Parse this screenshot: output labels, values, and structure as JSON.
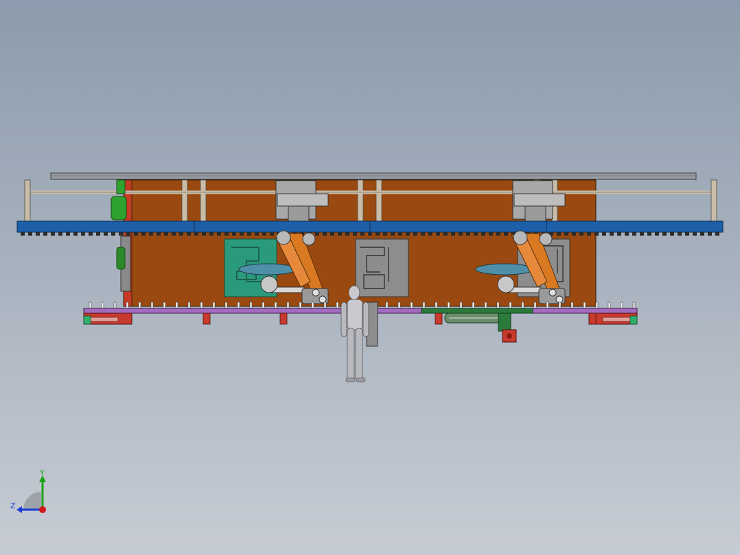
{
  "view": {
    "background_top": "#8c9bad",
    "background_bottom": "#c7ccd4"
  },
  "colors": {
    "frame_orange": "#9a4a10",
    "rail_blue": "#1d5fa8",
    "rail_blue_dark": "#0f3a6e",
    "guard_green": "#2a9a7c",
    "steel_grey": "#8d8d8d",
    "robot_orange": "#d97a23",
    "base_purple": "#a46cc0",
    "foot_red": "#c8392e",
    "mannequin_grey": "#c9c9cf"
  },
  "triad": {
    "y_label": "Y",
    "z_label": "Z",
    "y_color": "#1aa31a",
    "z_color": "#1a3ad8",
    "x_color": "#d01818"
  }
}
